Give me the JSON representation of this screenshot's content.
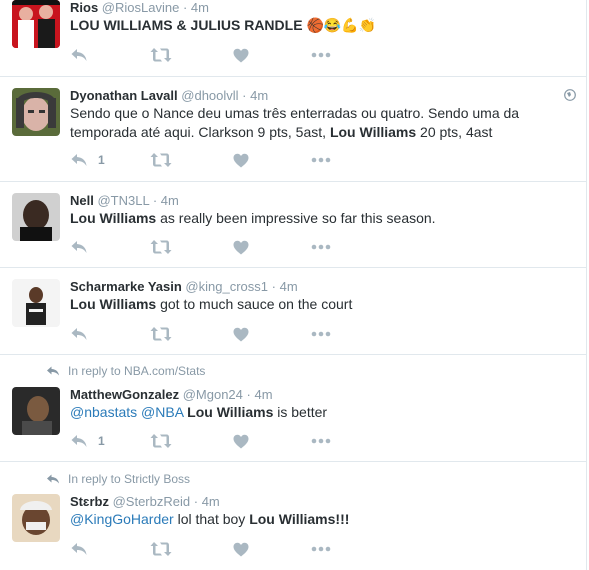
{
  "tweets": [
    {
      "name": "Rios",
      "handle": "@RiosLavine",
      "dot": "·",
      "time": "4m",
      "text_main": "LOU WILLIAMS & JULIUS RANDLE",
      "emoji": "🏀😂💪👏",
      "reply_count": "",
      "avatar_colors": [
        "#c8141e",
        "#e8b0a0",
        "#1a1a1a"
      ]
    },
    {
      "name": "Dyonathan Lavall",
      "handle": "@dhoolvll",
      "dot": "·",
      "time": "4m",
      "text_pre": "Sendo que o Nance deu umas três enterradas ou quatro. Sendo uma da temporada até aqui. Clarkson 9 pts, 5ast, ",
      "text_bold": "Lou Williams",
      "text_post": " 20 pts, 4ast",
      "reply_count": "1",
      "avatar_colors": [
        "#3a3a3a",
        "#d9b3a8",
        "#5a6b3a"
      ]
    },
    {
      "name": "Nell",
      "handle": "@TN3LL",
      "dot": "·",
      "time": "4m",
      "text_bold": "Lou Williams",
      "text_post": " as really been impressive so far this season.",
      "reply_count": "",
      "avatar_colors": [
        "#d0d0d0",
        "#3a2a22",
        "#111111"
      ]
    },
    {
      "name": "Scharmarke Yasin",
      "handle": "@king_cross1",
      "dot": "·",
      "time": "4m",
      "text_bold": "Lou Williams",
      "text_post": " got to much sauce on the court",
      "reply_count": "",
      "avatar_colors": [
        "#f4f4f4",
        "#5a3a28",
        "#222222"
      ]
    },
    {
      "reply_prefix": "In reply to",
      "reply_to": "NBA.com/Stats",
      "name": "MatthewGonzalez",
      "handle": "@Mgon24",
      "dot": "·",
      "time": "4m",
      "mention1": "@nbastats",
      "mention2": "@NBA",
      "text_bold": "Lou Williams",
      "text_post": " is better",
      "reply_count": "1",
      "avatar_colors": [
        "#2a2a2a",
        "#7a5a40",
        "#4a4a4a"
      ]
    },
    {
      "reply_prefix": "In reply to",
      "reply_to": "Strictly Boss",
      "name": "Stɛrbz",
      "handle": "@SterbzReid",
      "dot": "·",
      "time": "4m",
      "mention1": "@KingGoHarder",
      "text_pre": " lol that boy ",
      "text_bold": "Lou Williams",
      "text_post": "!!!",
      "reply_count": "",
      "avatar_colors": [
        "#e8d8c0",
        "#6a4630",
        "#f0f0f0"
      ]
    }
  ]
}
